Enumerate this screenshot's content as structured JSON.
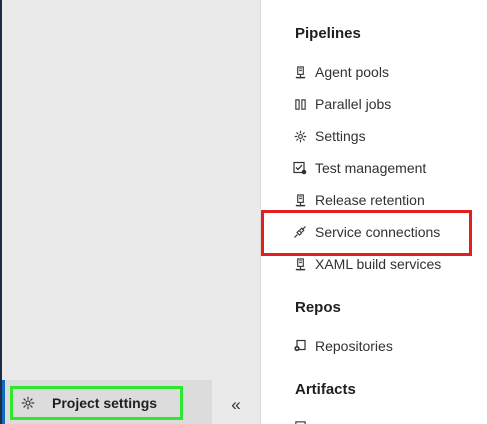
{
  "left_nav": {
    "project_settings_label": "Project settings",
    "project_settings_icon": "gear-icon",
    "collapse_icon": "double-chevron-left-icon"
  },
  "menu": {
    "groups": [
      {
        "title": "Pipelines",
        "items": [
          {
            "label": "Agent pools",
            "icon": "agent-pool-icon"
          },
          {
            "label": "Parallel jobs",
            "icon": "parallel-jobs-icon"
          },
          {
            "label": "Settings",
            "icon": "gear-icon"
          },
          {
            "label": "Test management",
            "icon": "test-management-icon"
          },
          {
            "label": "Release retention",
            "icon": "release-retention-icon"
          },
          {
            "label": "Service connections",
            "icon": "plug-icon"
          },
          {
            "label": "XAML build services",
            "icon": "build-services-icon"
          }
        ]
      },
      {
        "title": "Repos",
        "items": [
          {
            "label": "Repositories",
            "icon": "repository-icon"
          }
        ]
      },
      {
        "title": "Artifacts",
        "items": []
      }
    ]
  },
  "colors": {
    "left_pane_bg": "#eaeaea",
    "selected_accent": "#0f6cbd",
    "green_highlight": "#2ee82e",
    "red_highlight": "#e02020"
  }
}
